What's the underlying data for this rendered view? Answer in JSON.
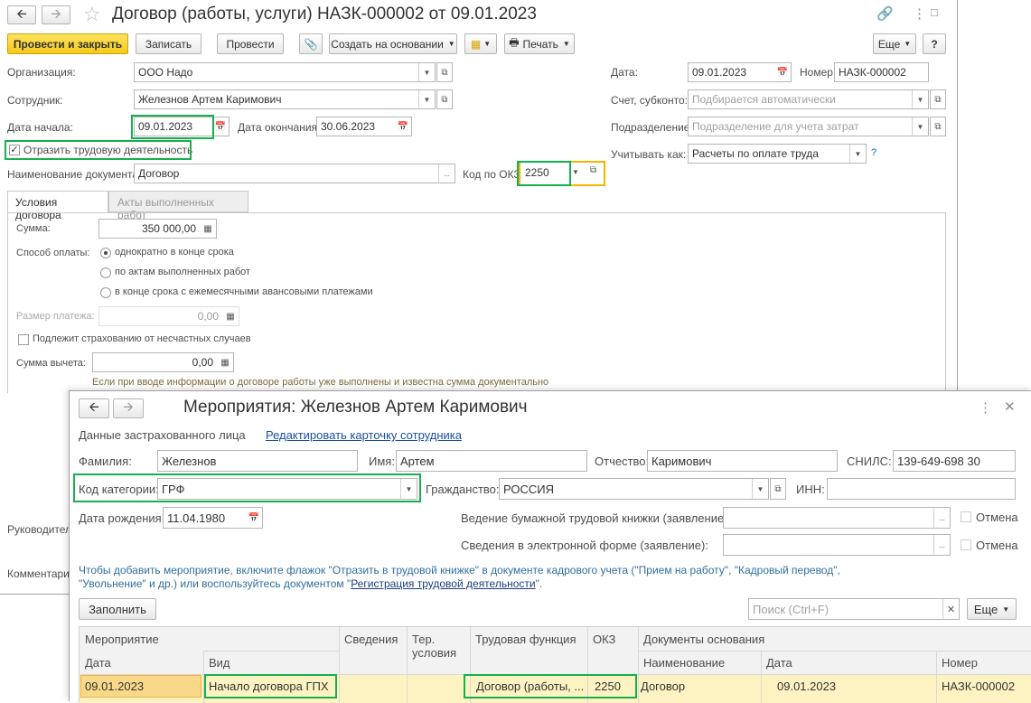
{
  "main": {
    "title": "Договор (работы, услуги) НАЗК-000002 от 09.01.2023",
    "toolbar": {
      "post_close": "Провести и закрыть",
      "save": "Записать",
      "post": "Провести",
      "create_based": "Создать на основании",
      "print": "Печать",
      "more": "Еще",
      "help": "?"
    },
    "org_label": "Организация:",
    "org_value": "ООО Надо",
    "emp_label": "Сотрудник:",
    "emp_value": "Железнов Артем Каримович",
    "start_label": "Дата начала:",
    "start_value": "09.01.2023",
    "end_label": "Дата окончания:",
    "end_value": "30.06.2023",
    "reflect_label": "Отразить трудовую деятельность",
    "docname_label": "Наименование документа:",
    "docname_value": "Договор",
    "okz_label": "Код по ОКЗ:",
    "okz_value": "2250",
    "date_label": "Дата:",
    "date_value": "09.01.2023",
    "number_label": "Номер:",
    "number_value": "НАЗК-000002",
    "account_label": "Счет, субконто:",
    "account_placeholder": "Подбирается автоматически",
    "dept_label": "Подразделение:",
    "dept_placeholder": "Подразделение для учета затрат",
    "consider_label": "Учитывать как:",
    "consider_value": "Расчеты по оплате труда",
    "consider_help": "?",
    "tabs": [
      "Условия договора",
      "Акты выполненных работ"
    ],
    "sum_label": "Сумма:",
    "sum_value": "350 000,00",
    "payment_label": "Способ оплаты:",
    "payment_options": [
      "однократно в конце срока",
      "по актам выполненных работ",
      "в конце срока с ежемесячными авансовыми платежами"
    ],
    "payment_size_label": "Размер платежа:",
    "payment_size_value": "0,00",
    "insurance_label": "Подлежит страхованию от несчастных случаев",
    "deduction_label": "Сумма вычета:",
    "deduction_value": "0,00",
    "deduction_hint": "Если при вводе информации о договоре работы уже выполнены и известна сумма документально",
    "head_label": "Руководител",
    "comment_label": "Комментари"
  },
  "dialog": {
    "title": "Мероприятия: Железнов Артем Каримович",
    "insured_label": "Данные застрахованного лица",
    "edit_card_link": "Редактировать карточку сотрудника",
    "lastname_label": "Фамилия:",
    "lastname_value": "Железнов",
    "firstname_label": "Имя:",
    "firstname_value": "Артем",
    "patronymic_label": "Отчество:",
    "patronymic_value": "Каримович",
    "snils_label": "СНИЛС:",
    "snils_value": "139-649-698 30",
    "category_label": "Код категории:",
    "category_value": "ГРФ",
    "citizenship_label": "Гражданство:",
    "citizenship_value": "РОССИЯ",
    "inn_label": "ИНН:",
    "inn_value": "",
    "birth_label": "Дата рождения:",
    "birth_value": "11.04.1980",
    "paper_book_label": "Ведение бумажной трудовой книжки (заявление):",
    "electronic_label": "Сведения в электронной форме (заявление):",
    "cancel_label": "Отмена",
    "info_text_1": "Чтобы добавить мероприятие, включите флажок \"Отразить в трудовой книжке\" в документе кадрового учета (\"Прием на работу\", \"Кадровый перевод\",",
    "info_text_2": "\"Увольнение\" и др.) или воспользуйтесь документом \"",
    "info_link": "Регистрация трудовой деятельности",
    "info_text_3": "\".",
    "fill_button": "Заполнить",
    "search_placeholder": "Поиск (Ctrl+F)",
    "more": "Еще",
    "table": {
      "h_event": "Мероприятие",
      "h_date": "Дата",
      "h_kind": "Вид",
      "h_info": "Сведения",
      "h_ter": "Тер. условия",
      "h_func": "Трудовая функция",
      "h_okz": "ОКЗ",
      "h_docs": "Документы основания",
      "h_name": "Наименование",
      "h_ddate": "Дата",
      "h_num": "Номер",
      "row": {
        "date": "09.01.2023",
        "kind": "Начало договора ГПХ",
        "info": "",
        "ter": "",
        "func": "Договор (работы, ...",
        "okz": "2250",
        "name": "Договор",
        "ddate": "09.01.2023",
        "num": "НАЗК-000002"
      }
    }
  }
}
